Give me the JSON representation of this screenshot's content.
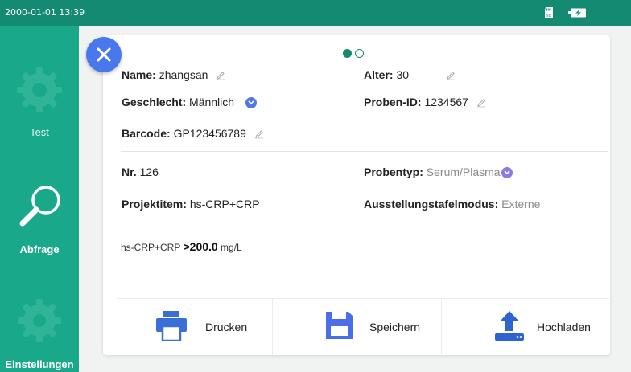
{
  "statusbar": {
    "time": "2000-01-01 13:39",
    "icons": [
      "sd-card-icon",
      "battery-charging-icon"
    ]
  },
  "sidebar": {
    "items": [
      {
        "label": "Test",
        "icon": "gear-icon",
        "active": false
      },
      {
        "label": "Abfrage",
        "icon": "magnifier-icon",
        "active": true
      },
      {
        "label": "Einstellungen",
        "icon": "gear-icon",
        "active": false
      }
    ]
  },
  "pager": {
    "pages": 2,
    "current": 1
  },
  "patient": {
    "name_label": "Name:",
    "name_value": "zhangsan",
    "age_label": "Alter:",
    "age_value": "30",
    "gender_label": "Geschlecht:",
    "gender_value": "Männlich",
    "sample_id_label": "Proben-ID:",
    "sample_id_value": "1234567",
    "barcode_label": "Barcode:",
    "barcode_value": "GP123456789"
  },
  "sample": {
    "nr_label": "Nr.",
    "nr_value": "126",
    "type_label": "Probentyp:",
    "type_value": "Serum/Plasma",
    "project_label": "Projektitem:",
    "project_value": "hs-CRP+CRP",
    "mode_label": "Ausstellungstafelmodus:",
    "mode_value": "Externe"
  },
  "result": {
    "item": "hs-CRP+CRP",
    "value": ">200.0",
    "unit": "mg/L"
  },
  "actions": {
    "print": "Drucken",
    "save": "Speichern",
    "upload": "Hochladen"
  },
  "colors": {
    "statusbar": "#138a71",
    "sidebar": "#1aa88a",
    "accent": "#4878ec",
    "print_icon": "#3a6fd8",
    "save_icon": "#4a6ee8",
    "upload_icon": "#2f63d0"
  }
}
